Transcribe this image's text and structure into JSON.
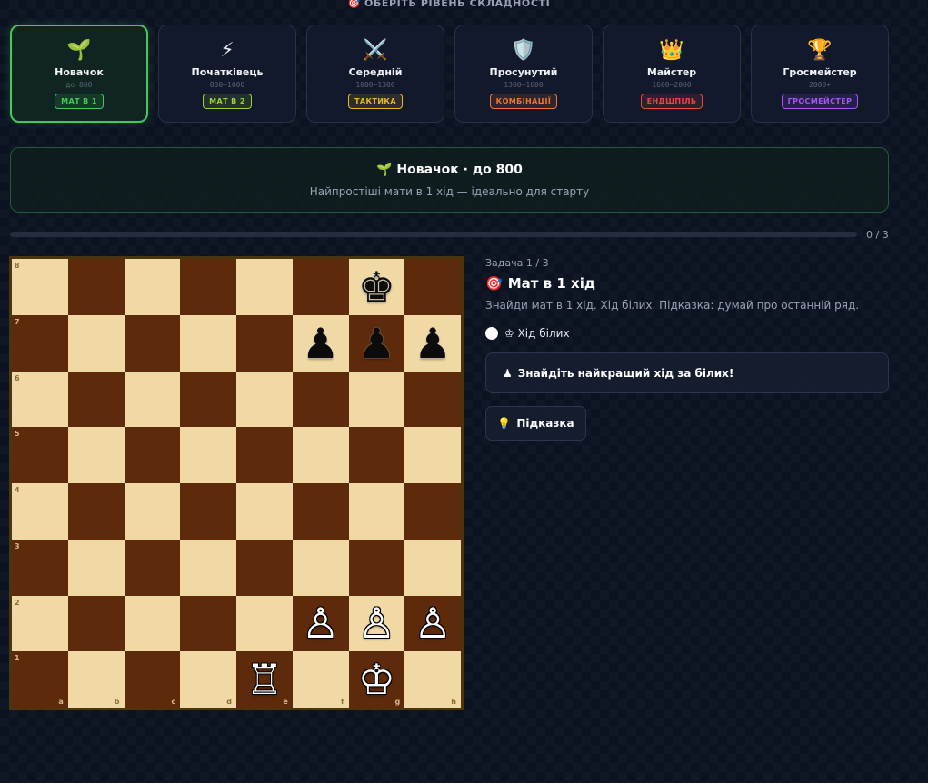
{
  "header": {
    "title": "ОБЕРІТЬ РІВЕНЬ СКЛАДНОСТІ",
    "icon": "target-icon"
  },
  "levels": [
    {
      "name": "Новачок",
      "range": "до 800",
      "badge": "МАТ В 1",
      "icon": "seedling-icon",
      "badge_color": "#3ecb5c",
      "active": true
    },
    {
      "name": "Початківець",
      "range": "800–1000",
      "badge": "МАТ В 2",
      "icon": "lightning-icon",
      "badge_color": "#9bd431",
      "active": false
    },
    {
      "name": "Середній",
      "range": "1000–1300",
      "badge": "ТАКТИКА",
      "icon": "crossed-swords-icon",
      "badge_color": "#e8b826",
      "active": false
    },
    {
      "name": "Просунутий",
      "range": "1300–1600",
      "badge": "КОМБІНАЦІЇ",
      "icon": "shield-icon",
      "badge_color": "#f2762e",
      "active": false
    },
    {
      "name": "Майстер",
      "range": "1600–2000",
      "badge": "ЕНДШПІЛЬ",
      "icon": "crown-icon",
      "badge_color": "#ef4444",
      "active": false
    },
    {
      "name": "Гросмейстер",
      "range": "2000+",
      "badge": "ГРОСМЕЙСТЕР",
      "icon": "trophy-icon",
      "badge_color": "#a855f7",
      "active": false
    }
  ],
  "info": {
    "title": "Новачок · до 800",
    "description": "Найпростіші мати в 1 хід — ідеально для старту",
    "icon": "seedling-icon"
  },
  "progress": {
    "text": "0 / 3",
    "fraction": 0
  },
  "board": {
    "files": [
      "a",
      "b",
      "c",
      "d",
      "e",
      "f",
      "g",
      "h"
    ],
    "ranks": [
      "8",
      "7",
      "6",
      "5",
      "4",
      "3",
      "2",
      "1"
    ],
    "pieces": [
      {
        "square": "g8",
        "piece": "king",
        "color": "black"
      },
      {
        "square": "f7",
        "piece": "pawn",
        "color": "black"
      },
      {
        "square": "g7",
        "piece": "pawn",
        "color": "black"
      },
      {
        "square": "h7",
        "piece": "pawn",
        "color": "black"
      },
      {
        "square": "f2",
        "piece": "pawn",
        "color": "white"
      },
      {
        "square": "g2",
        "piece": "pawn",
        "color": "white"
      },
      {
        "square": "h2",
        "piece": "pawn",
        "color": "white"
      },
      {
        "square": "e1",
        "piece": "rook",
        "color": "white"
      },
      {
        "square": "g1",
        "piece": "king",
        "color": "white"
      }
    ]
  },
  "puzzle": {
    "counter": "Задача 1 / 3",
    "title": "Мат в 1 хід",
    "title_icon": "target-icon",
    "description": "Знайди мат в 1 хід. Хід білих. Підказка: думай про останній ряд.",
    "turn_label": "♔ Хід білих",
    "status": "Знайдіть найкращий хід за білих!",
    "status_icon": "pawn-icon",
    "hint_label": "Підказка",
    "hint_icon": "lightbulb-icon"
  }
}
